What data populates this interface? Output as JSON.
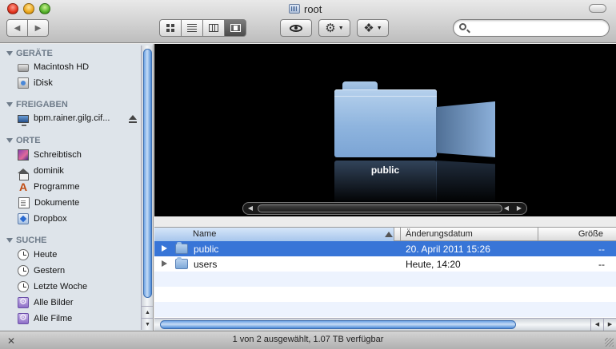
{
  "window": {
    "title": "root"
  },
  "toolbar": {
    "back_icon": "◀",
    "forward_icon": "▶",
    "view_modes": [
      "icon-view",
      "list-view",
      "column-view",
      "cover-flow-view"
    ],
    "active_view": "cover-flow-view",
    "search": {
      "value": "",
      "placeholder": ""
    }
  },
  "sidebar": {
    "sections": [
      {
        "title": "GERÄTE",
        "items": [
          {
            "label": "Macintosh HD",
            "icon": "hard-drive-icon"
          },
          {
            "label": "iDisk",
            "icon": "idisk-icon"
          }
        ]
      },
      {
        "title": "FREIGABEN",
        "items": [
          {
            "label": "bpm.rainer.gilg.cif...",
            "icon": "network-screen-icon",
            "eject": true
          }
        ]
      },
      {
        "title": "ORTE",
        "items": [
          {
            "label": "Schreibtisch",
            "icon": "desktop-icon"
          },
          {
            "label": "dominik",
            "icon": "home-icon"
          },
          {
            "label": "Programme",
            "icon": "applications-icon"
          },
          {
            "label": "Dokumente",
            "icon": "documents-icon"
          },
          {
            "label": "Dropbox",
            "icon": "dropbox-icon"
          }
        ]
      },
      {
        "title": "SUCHE",
        "items": [
          {
            "label": "Heute",
            "icon": "clock-icon"
          },
          {
            "label": "Gestern",
            "icon": "clock-icon"
          },
          {
            "label": "Letzte Woche",
            "icon": "clock-icon"
          },
          {
            "label": "Alle Bilder",
            "icon": "smart-folder-icon"
          },
          {
            "label": "Alle Filme",
            "icon": "smart-folder-icon"
          }
        ]
      }
    ]
  },
  "coverflow": {
    "current_label": "public"
  },
  "list": {
    "columns": {
      "name": "Name",
      "date": "Änderungsdatum",
      "size": "Größe"
    },
    "rows": [
      {
        "name": "public",
        "date": "20. April 2011 15:26",
        "size": "--",
        "selected": true
      },
      {
        "name": "users",
        "date": "Heute, 14:20",
        "size": "--",
        "selected": false
      }
    ]
  },
  "status": {
    "text": "1 von 2 ausgewählt, 1.07 TB verfügbar"
  },
  "colors": {
    "selection": "#3875d7",
    "sidebar_bg": "#dee4ea",
    "section_header": "#6f7c8a"
  }
}
